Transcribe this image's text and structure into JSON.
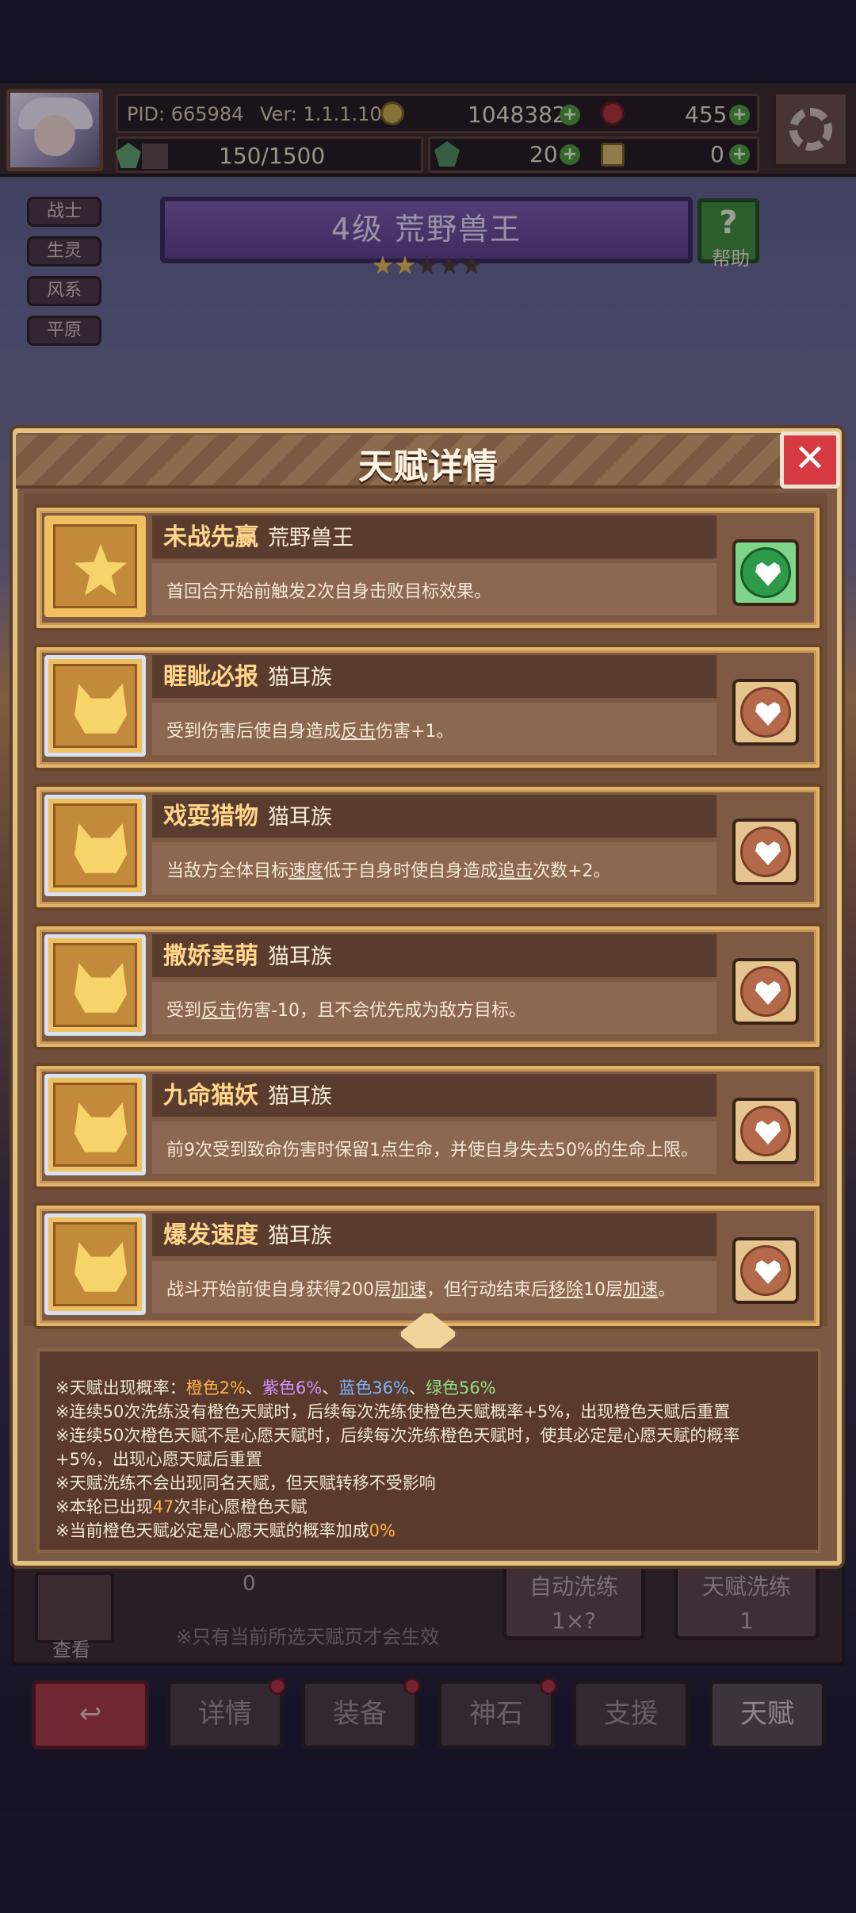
{
  "header": {
    "pid": "PID: 665984",
    "version": "Ver: 1.1.1.10",
    "gold": "1048382",
    "gems": "455",
    "stamina": "150/1500",
    "stamina_fraction": 0.1,
    "clover": "20",
    "tools": "0"
  },
  "side_tags": [
    "战士",
    "生灵",
    "风系",
    "平原"
  ],
  "hero": {
    "banner": "4级  荒野兽王",
    "stars_filled": 2,
    "stars_total": 5,
    "help_label": "帮助"
  },
  "dialog": {
    "title": "天赋详情",
    "talents": [
      {
        "name": "未战先赢",
        "tribe": "荒野兽王",
        "desc_parts": [
          "首回合开始前触发2次自身击败目标效果。"
        ],
        "icon": "star-icon",
        "wished": true
      },
      {
        "name": "睚眦必报",
        "tribe": "猫耳族",
        "desc_parts": [
          "受到伤害后使自身造成",
          "反击",
          "伤害+1。"
        ],
        "icon": "cat-icon",
        "wished": false
      },
      {
        "name": "戏耍猎物",
        "tribe": "猫耳族",
        "desc_parts": [
          "当敌方全体目标",
          "速度",
          "低于自身时使自身造成",
          "追击",
          "次数+2。"
        ],
        "icon": "cat-icon",
        "wished": false
      },
      {
        "name": "撒娇卖萌",
        "tribe": "猫耳族",
        "desc_parts": [
          "受到",
          "反击",
          "伤害-10，且不会优先成为敌方目标。"
        ],
        "icon": "cat-icon",
        "wished": false
      },
      {
        "name": "九命猫妖",
        "tribe": "猫耳族",
        "desc_parts": [
          "前9次受到致命伤害时保留1点生命，并使自身失去50%的生命上限。"
        ],
        "icon": "cat-icon",
        "wished": false
      },
      {
        "name": "爆发速度",
        "tribe": "猫耳族",
        "desc_parts": [
          "战斗开始前使自身获得200层",
          "加速",
          "，但行动结束后",
          "移除",
          "10层",
          "加速",
          "。"
        ],
        "icon": "cat-icon",
        "wished": false
      }
    ],
    "info": {
      "prob_prefix": "※天赋出现概率：",
      "orange": "橙色2%",
      "sep": "、",
      "purple": "紫色6%",
      "blue": "蓝色36%",
      "green": "绿色56%",
      "line2": "※连续50次洗练没有橙色天赋时，后续每次洗练使橙色天赋概率+5%，出现橙色天赋后重置",
      "line3": "※连续50次橙色天赋不是心愿天赋时，后续每次洗练橙色天赋时，使其必定是心愿天赋的概率",
      "line4": "+5%，出现心愿天赋后重置",
      "line5": "※天赋洗练不会出现同名天赋，但天赋转移不受影响",
      "line6_pre": "※本轮已出现",
      "line6_num": "47",
      "line6_post": "次非心愿橙色天赋",
      "line7_pre": "※当前橙色天赋必定是心愿天赋的概率加成",
      "line7_num": "0%"
    }
  },
  "underlying": {
    "search_label": "查看",
    "count": "0",
    "note": "※只有当前所选天赋页才会生效",
    "auto_refine": "自动洗练",
    "auto_refine_count": "1×?",
    "talent_refine": "天赋洗练",
    "talent_refine_count": "1"
  },
  "nav": {
    "items": [
      "详情",
      "装备",
      "神石",
      "支援",
      "天赋"
    ]
  },
  "colors": {
    "orange": "#ffb24a",
    "purple": "#d592ff",
    "blue": "#7ab6ff",
    "green": "#8ee28a",
    "wish_active": "#2d9a4a"
  }
}
